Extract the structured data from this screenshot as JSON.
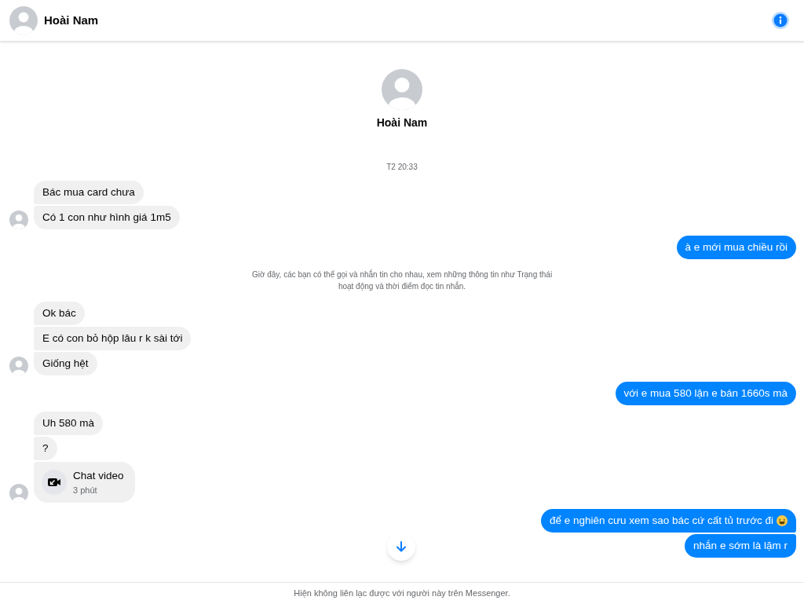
{
  "header": {
    "name": "Hoài Nam"
  },
  "profile": {
    "name": "Hoài Nam"
  },
  "timeline": [
    {
      "kind": "timestamp",
      "text": "T2 20:33"
    },
    {
      "kind": "group",
      "outgoing": false,
      "messages": [
        {
          "kind": "text",
          "text": "Bác mua card chưa"
        },
        {
          "kind": "text",
          "text": "Có 1 con như hình giá 1m5"
        }
      ]
    },
    {
      "kind": "group",
      "outgoing": true,
      "messages": [
        {
          "kind": "text",
          "text": "à e mới mua chiều rồi"
        }
      ]
    },
    {
      "kind": "notice",
      "text": "Giờ đây, các bạn có thể gọi và nhắn tin cho nhau, xem những thông tin như Trạng thái hoạt động và thời điểm đọc tin nhắn."
    },
    {
      "kind": "group",
      "outgoing": false,
      "messages": [
        {
          "kind": "text",
          "text": "Ok bác"
        },
        {
          "kind": "text",
          "text": "E có con bỏ hộp lâu r k sài tới"
        },
        {
          "kind": "text",
          "text": "Giống hệt"
        }
      ]
    },
    {
      "kind": "group",
      "outgoing": true,
      "messages": [
        {
          "kind": "text",
          "text": "với e mua 580 lận e bán 1660s mà"
        }
      ]
    },
    {
      "kind": "group",
      "outgoing": false,
      "messages": [
        {
          "kind": "text",
          "text": "Uh 580 mà"
        },
        {
          "kind": "text",
          "text": "?"
        },
        {
          "kind": "call",
          "title": "Chat video",
          "duration": "3 phút"
        }
      ]
    },
    {
      "kind": "group",
      "outgoing": true,
      "messages": [
        {
          "kind": "text",
          "text": "để e nghiên cưu xem sao bác cứ cất tủ trước đi",
          "emoji": true
        },
        {
          "kind": "text",
          "text": "nhắn e sớm là lặm r"
        }
      ]
    }
  ],
  "footer": {
    "text": "Hiện không liên lạc được với người này trên Messenger."
  }
}
